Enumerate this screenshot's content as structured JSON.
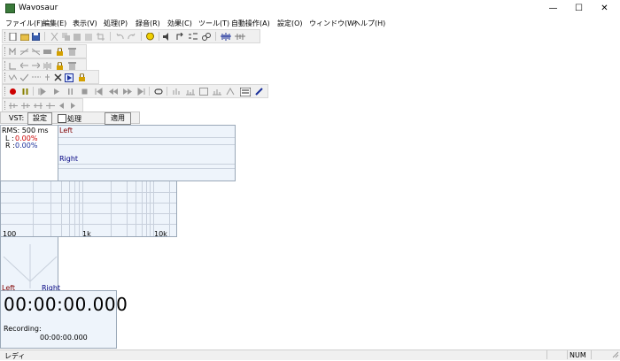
{
  "window": {
    "title": "Wavosaur",
    "controls": {
      "minimize": "—",
      "maximize": "☐",
      "close": "✕"
    }
  },
  "menu": [
    "ファイル(F)",
    "編集(E)",
    "表示(V)",
    "処理(P)",
    "録音(R)",
    "効果(C)",
    "ツール(T)",
    "自動操作(A)",
    "設定(O)",
    "ウィンドウ(W)",
    "ヘルプ(H)"
  ],
  "vst": {
    "label": "VST:",
    "settings_button": "設定",
    "process_label": "処理",
    "apply_button": "適用"
  },
  "rms": {
    "title": "RMS: 500 ms",
    "left_label": "L :",
    "left_value": "0.00%",
    "right_label": "R :",
    "right_value": "0.00%"
  },
  "meter": {
    "left": "Left",
    "right": "Right"
  },
  "spectrum": {
    "labels": [
      "100",
      "1k",
      "10k"
    ]
  },
  "scope": {
    "left": "Left",
    "right": "Right"
  },
  "timer": {
    "time": "00:00:00.000",
    "recording_label": "Recording:",
    "recording_time": "00:00:00.000"
  },
  "status": {
    "text": "レディ",
    "num": "NUM"
  },
  "colors": {
    "accent_red": "#cc0000",
    "accent_blue": "#1a2f9a",
    "left_label": "#800000",
    "right_label": "#000080",
    "lock": "#d4a000"
  }
}
